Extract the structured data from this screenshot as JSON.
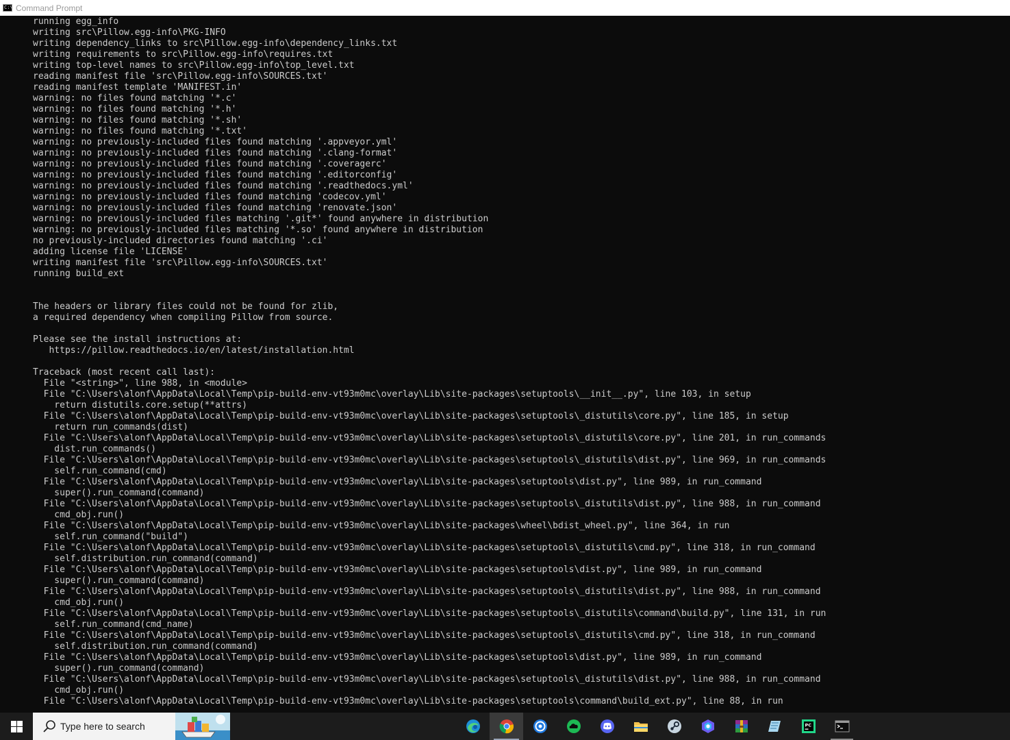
{
  "window": {
    "title": "Command Prompt",
    "icon": "cmd-icon"
  },
  "console": {
    "lines": [
      "running egg_info",
      "writing src\\Pillow.egg-info\\PKG-INFO",
      "writing dependency_links to src\\Pillow.egg-info\\dependency_links.txt",
      "writing requirements to src\\Pillow.egg-info\\requires.txt",
      "writing top-level names to src\\Pillow.egg-info\\top_level.txt",
      "reading manifest file 'src\\Pillow.egg-info\\SOURCES.txt'",
      "reading manifest template 'MANIFEST.in'",
      "warning: no files found matching '*.c'",
      "warning: no files found matching '*.h'",
      "warning: no files found matching '*.sh'",
      "warning: no files found matching '*.txt'",
      "warning: no previously-included files found matching '.appveyor.yml'",
      "warning: no previously-included files found matching '.clang-format'",
      "warning: no previously-included files found matching '.coveragerc'",
      "warning: no previously-included files found matching '.editorconfig'",
      "warning: no previously-included files found matching '.readthedocs.yml'",
      "warning: no previously-included files found matching 'codecov.yml'",
      "warning: no previously-included files found matching 'renovate.json'",
      "warning: no previously-included files matching '.git*' found anywhere in distribution",
      "warning: no previously-included files matching '*.so' found anywhere in distribution",
      "no previously-included directories found matching '.ci'",
      "adding license file 'LICENSE'",
      "writing manifest file 'src\\Pillow.egg-info\\SOURCES.txt'",
      "running build_ext",
      "",
      "",
      "The headers or library files could not be found for zlib,",
      "a required dependency when compiling Pillow from source.",
      "",
      "Please see the install instructions at:",
      "   https://pillow.readthedocs.io/en/latest/installation.html",
      "",
      "Traceback (most recent call last):",
      "  File \"<string>\", line 988, in <module>",
      "  File \"C:\\Users\\alonf\\AppData\\Local\\Temp\\pip-build-env-vt93m0mc\\overlay\\Lib\\site-packages\\setuptools\\__init__.py\", line 103, in setup",
      "    return distutils.core.setup(**attrs)",
      "  File \"C:\\Users\\alonf\\AppData\\Local\\Temp\\pip-build-env-vt93m0mc\\overlay\\Lib\\site-packages\\setuptools\\_distutils\\core.py\", line 185, in setup",
      "    return run_commands(dist)",
      "  File \"C:\\Users\\alonf\\AppData\\Local\\Temp\\pip-build-env-vt93m0mc\\overlay\\Lib\\site-packages\\setuptools\\_distutils\\core.py\", line 201, in run_commands",
      "    dist.run_commands()",
      "  File \"C:\\Users\\alonf\\AppData\\Local\\Temp\\pip-build-env-vt93m0mc\\overlay\\Lib\\site-packages\\setuptools\\_distutils\\dist.py\", line 969, in run_commands",
      "    self.run_command(cmd)",
      "  File \"C:\\Users\\alonf\\AppData\\Local\\Temp\\pip-build-env-vt93m0mc\\overlay\\Lib\\site-packages\\setuptools\\dist.py\", line 989, in run_command",
      "    super().run_command(command)",
      "  File \"C:\\Users\\alonf\\AppData\\Local\\Temp\\pip-build-env-vt93m0mc\\overlay\\Lib\\site-packages\\setuptools\\_distutils\\dist.py\", line 988, in run_command",
      "    cmd_obj.run()",
      "  File \"C:\\Users\\alonf\\AppData\\Local\\Temp\\pip-build-env-vt93m0mc\\overlay\\Lib\\site-packages\\wheel\\bdist_wheel.py\", line 364, in run",
      "    self.run_command(\"build\")",
      "  File \"C:\\Users\\alonf\\AppData\\Local\\Temp\\pip-build-env-vt93m0mc\\overlay\\Lib\\site-packages\\setuptools\\_distutils\\cmd.py\", line 318, in run_command",
      "    self.distribution.run_command(command)",
      "  File \"C:\\Users\\alonf\\AppData\\Local\\Temp\\pip-build-env-vt93m0mc\\overlay\\Lib\\site-packages\\setuptools\\dist.py\", line 989, in run_command",
      "    super().run_command(command)",
      "  File \"C:\\Users\\alonf\\AppData\\Local\\Temp\\pip-build-env-vt93m0mc\\overlay\\Lib\\site-packages\\setuptools\\_distutils\\dist.py\", line 988, in run_command",
      "    cmd_obj.run()",
      "  File \"C:\\Users\\alonf\\AppData\\Local\\Temp\\pip-build-env-vt93m0mc\\overlay\\Lib\\site-packages\\setuptools\\_distutils\\command\\build.py\", line 131, in run",
      "    self.run_command(cmd_name)",
      "  File \"C:\\Users\\alonf\\AppData\\Local\\Temp\\pip-build-env-vt93m0mc\\overlay\\Lib\\site-packages\\setuptools\\_distutils\\cmd.py\", line 318, in run_command",
      "    self.distribution.run_command(command)",
      "  File \"C:\\Users\\alonf\\AppData\\Local\\Temp\\pip-build-env-vt93m0mc\\overlay\\Lib\\site-packages\\setuptools\\dist.py\", line 989, in run_command",
      "    super().run_command(command)",
      "  File \"C:\\Users\\alonf\\AppData\\Local\\Temp\\pip-build-env-vt93m0mc\\overlay\\Lib\\site-packages\\setuptools\\_distutils\\dist.py\", line 988, in run_command",
      "    cmd_obj.run()",
      "  File \"C:\\Users\\alonf\\AppData\\Local\\Temp\\pip-build-env-vt93m0mc\\overlay\\Lib\\site-packages\\setuptools\\command\\build_ext.py\", line 88, in run"
    ]
  },
  "taskbar": {
    "search_placeholder": "Type here to search",
    "apps": [
      {
        "name": "edge-icon",
        "active": false
      },
      {
        "name": "chrome-icon",
        "active": true
      },
      {
        "name": "uplay-icon",
        "active": false
      },
      {
        "name": "cloud-app-icon",
        "active": false
      },
      {
        "name": "discord-icon",
        "active": false
      },
      {
        "name": "file-explorer-icon",
        "active": false
      },
      {
        "name": "steam-icon",
        "active": false
      },
      {
        "name": "copilot-icon",
        "active": false
      },
      {
        "name": "winrar-icon",
        "active": false
      },
      {
        "name": "notepad-icon",
        "active": false
      },
      {
        "name": "pycharm-icon",
        "active": false
      },
      {
        "name": "command-prompt-icon",
        "active": false
      }
    ]
  },
  "colors": {
    "console_bg": "#0c0c0c",
    "console_text": "#cccccc",
    "taskbar_bg": "#1c1c1c"
  }
}
